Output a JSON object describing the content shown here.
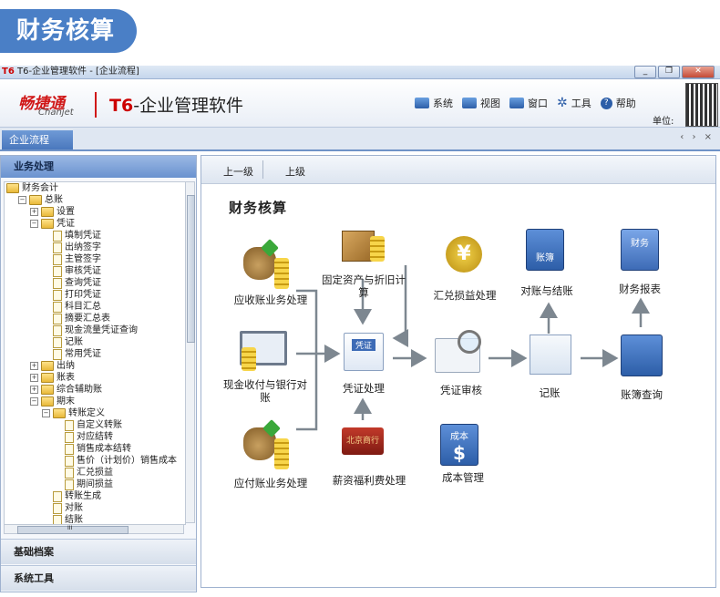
{
  "banner": {
    "title": "财务核算"
  },
  "window": {
    "logo": "T6",
    "title": "T6-企业管理软件 - [企业流程]"
  },
  "header": {
    "logo_cn": "畅捷通",
    "logo_en": "Chanjet",
    "product_prefix": "T6",
    "product_name": "-企业管理软件",
    "menu": [
      {
        "label": "系统",
        "icon": "monitor-icon"
      },
      {
        "label": "视图",
        "icon": "grid-icon"
      },
      {
        "label": "窗口",
        "icon": "window-icon"
      },
      {
        "label": "工具",
        "icon": "gear-icon"
      },
      {
        "label": "帮助",
        "icon": "help-icon"
      }
    ],
    "unit_label": "单位:"
  },
  "tabbar": {
    "active_tab": "企业流程",
    "controls": "‹ › ×"
  },
  "sidebar": {
    "section": "业务处理",
    "tree": [
      {
        "label": "财务会计",
        "level": 0,
        "kind": "folder",
        "exp": ""
      },
      {
        "label": "总账",
        "level": 1,
        "kind": "folder",
        "exp": "−"
      },
      {
        "label": "设置",
        "level": 2,
        "kind": "folder",
        "exp": "+"
      },
      {
        "label": "凭证",
        "level": 2,
        "kind": "folder",
        "exp": "−"
      },
      {
        "label": "填制凭证",
        "level": 3,
        "kind": "doc",
        "exp": ""
      },
      {
        "label": "出纳签字",
        "level": 3,
        "kind": "doc",
        "exp": ""
      },
      {
        "label": "主管签字",
        "level": 3,
        "kind": "doc",
        "exp": ""
      },
      {
        "label": "审核凭证",
        "level": 3,
        "kind": "doc",
        "exp": ""
      },
      {
        "label": "查询凭证",
        "level": 3,
        "kind": "doc",
        "exp": ""
      },
      {
        "label": "打印凭证",
        "level": 3,
        "kind": "doc",
        "exp": ""
      },
      {
        "label": "科目汇总",
        "level": 3,
        "kind": "doc",
        "exp": ""
      },
      {
        "label": "摘要汇总表",
        "level": 3,
        "kind": "doc",
        "exp": ""
      },
      {
        "label": "现金流量凭证查询",
        "level": 3,
        "kind": "doc",
        "exp": ""
      },
      {
        "label": "记账",
        "level": 3,
        "kind": "doc",
        "exp": ""
      },
      {
        "label": "常用凭证",
        "level": 3,
        "kind": "doc",
        "exp": ""
      },
      {
        "label": "出纳",
        "level": 2,
        "kind": "folder",
        "exp": "+"
      },
      {
        "label": "账表",
        "level": 2,
        "kind": "folder",
        "exp": "+"
      },
      {
        "label": "综合辅助账",
        "level": 2,
        "kind": "folder",
        "exp": "+"
      },
      {
        "label": "期末",
        "level": 2,
        "kind": "folder",
        "exp": "−"
      },
      {
        "label": "转账定义",
        "level": 3,
        "kind": "folder",
        "exp": "−"
      },
      {
        "label": "自定义转账",
        "level": 4,
        "kind": "doc",
        "exp": ""
      },
      {
        "label": "对应结转",
        "level": 4,
        "kind": "doc",
        "exp": ""
      },
      {
        "label": "销售成本结转",
        "level": 4,
        "kind": "doc",
        "exp": ""
      },
      {
        "label": "售价（计划价）销售成本",
        "level": 4,
        "kind": "doc",
        "exp": ""
      },
      {
        "label": "汇兑损益",
        "level": 4,
        "kind": "doc",
        "exp": ""
      },
      {
        "label": "期间损益",
        "level": 4,
        "kind": "doc",
        "exp": ""
      },
      {
        "label": "转账生成",
        "level": 3,
        "kind": "doc",
        "exp": ""
      },
      {
        "label": "对账",
        "level": 3,
        "kind": "doc",
        "exp": ""
      },
      {
        "label": "结账",
        "level": 3,
        "kind": "doc",
        "exp": ""
      }
    ],
    "basic_archive": "基础档案",
    "system_tools": "系统工具",
    "hscroll_mark": "III"
  },
  "content": {
    "nav_up": "上一级",
    "nav_prev": "上级",
    "flow_title": "财务核算",
    "nodes": {
      "receivable": "应收账业务处理",
      "fixed_assets": "固定资产与折旧计算",
      "exchange": "汇兑损益处理",
      "reconcile": "对账与结账",
      "reports": "财务报表",
      "cash_bank": "现金收付与银行对账",
      "voucher": "凭证处理",
      "audit": "凭证审核",
      "posting": "记账",
      "ledger_query": "账簿查询",
      "payable": "应付账业务处理",
      "payroll": "薪资福利费处理",
      "cost": "成本管理"
    },
    "icon_texts": {
      "voucher": "凭证",
      "reports": "财务",
      "reconcile": "账簿",
      "cost": "成本",
      "payroll": "北京商行"
    }
  },
  "colors": {
    "accent": "#4a7fc6",
    "brand_red": "#d01818",
    "arrow": "#7d8790"
  }
}
